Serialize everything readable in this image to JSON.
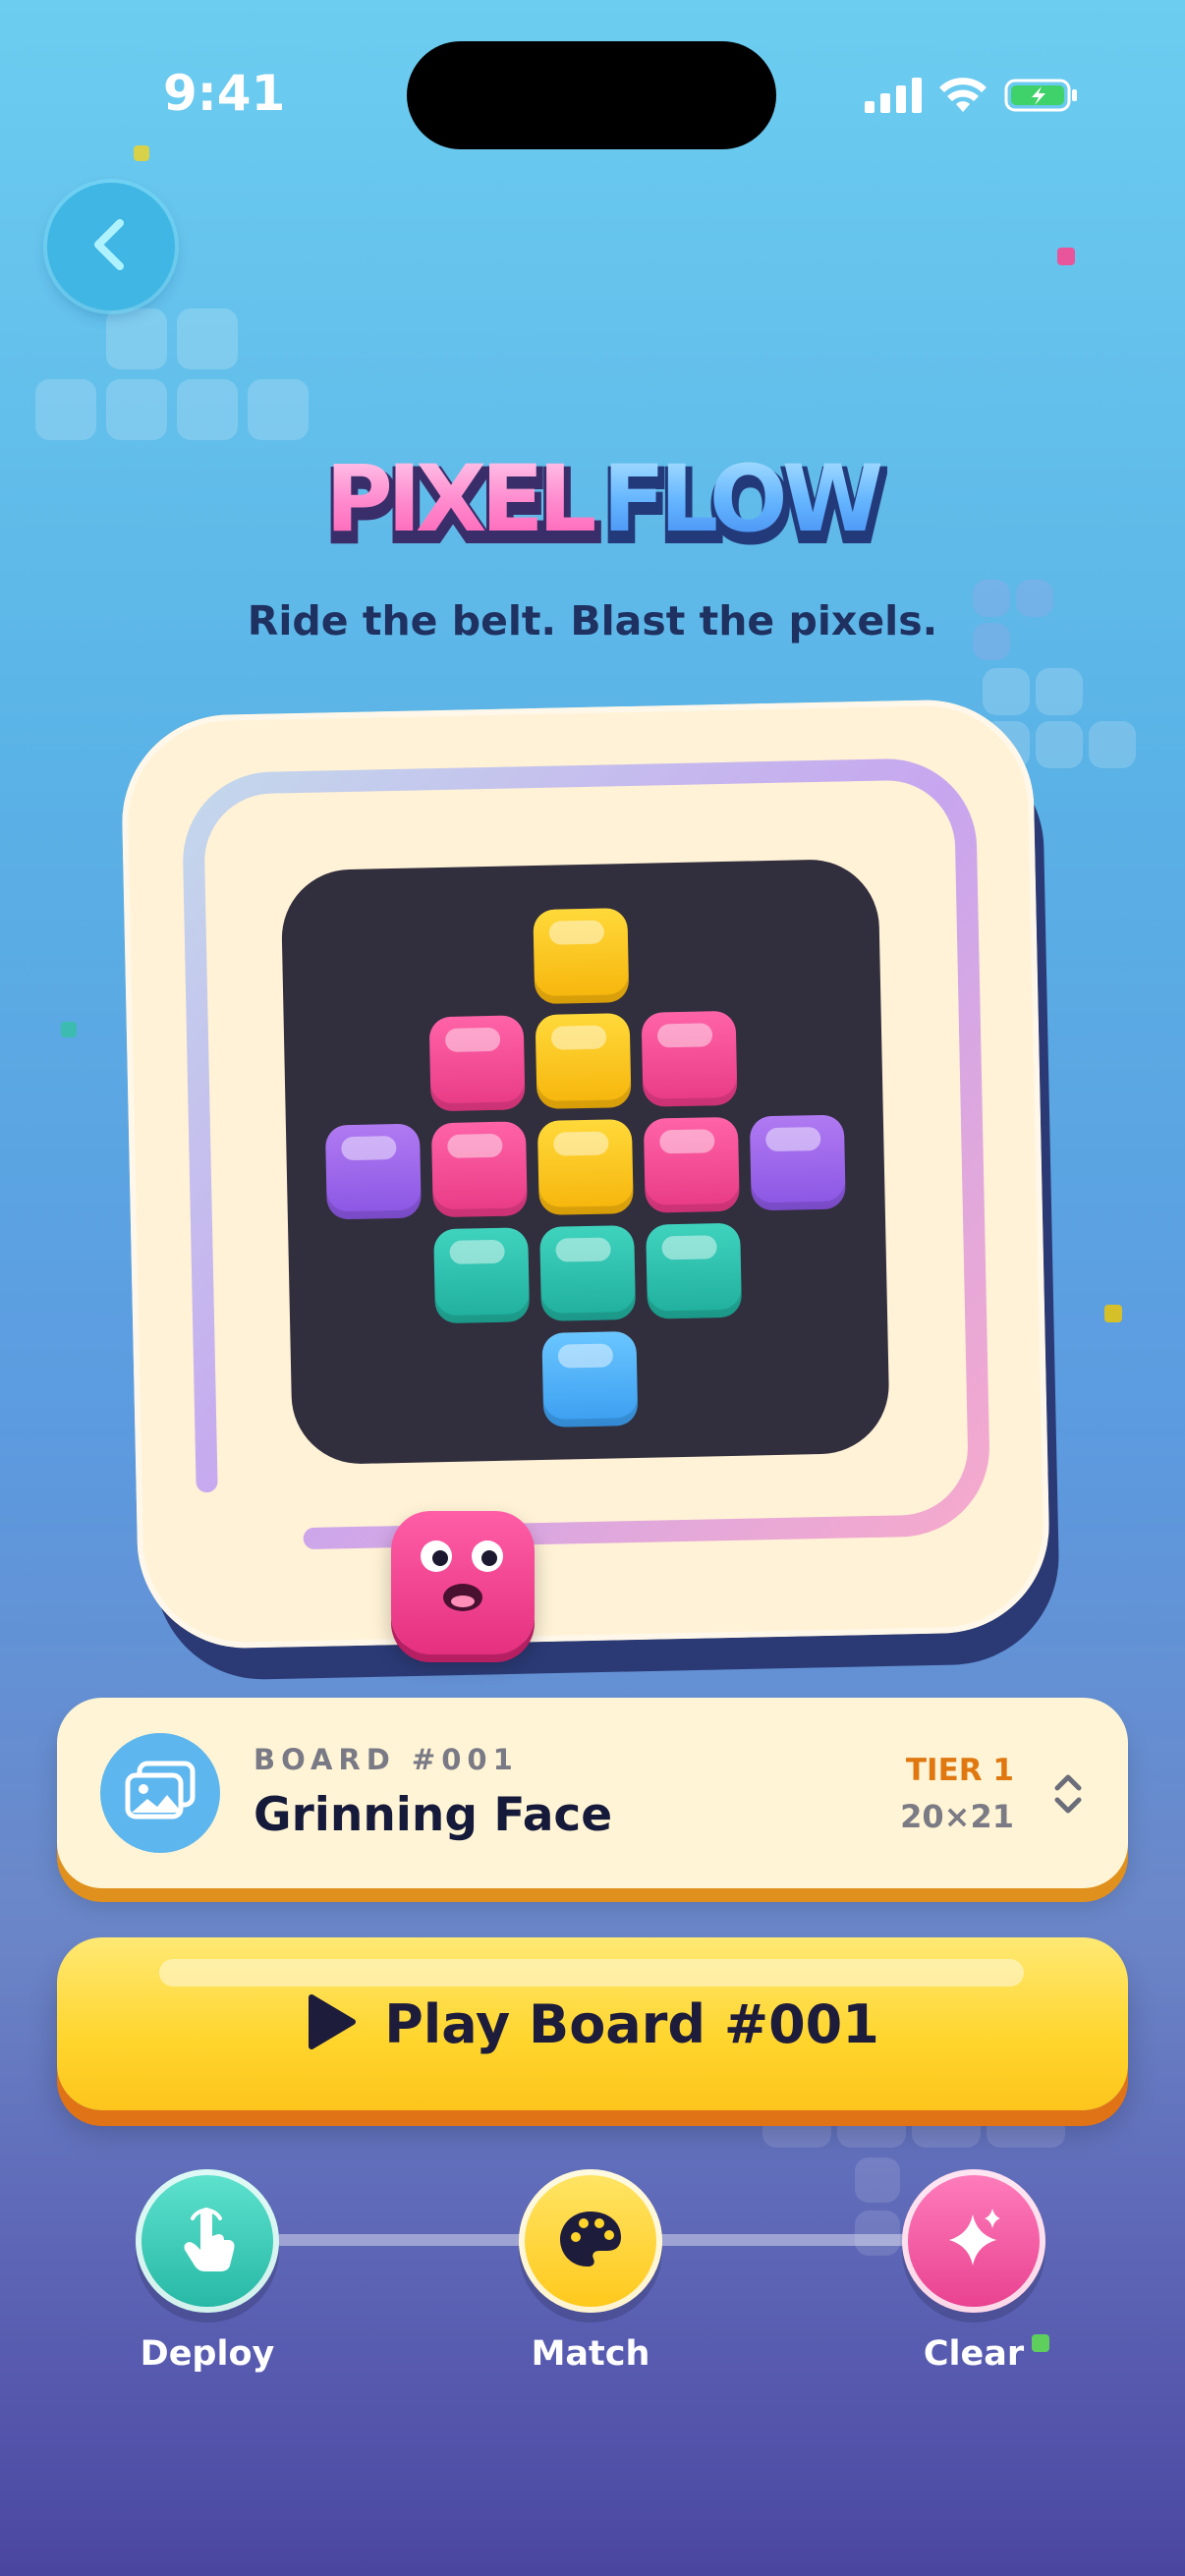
{
  "status_bar": {
    "time": "9:41"
  },
  "header": {
    "title_part1": "PIXEL",
    "title_part2": "FLOW",
    "tagline": "Ride the belt. Blast the pixels."
  },
  "board_card": {
    "board_number": "BOARD #001",
    "board_name": "Grinning Face",
    "tier": "TIER 1",
    "size": "20×21"
  },
  "play_button": {
    "label": "Play Board #001"
  },
  "steps": [
    {
      "label": "Deploy",
      "icon": "tap-hand-icon"
    },
    {
      "label": "Match",
      "icon": "palette-icon"
    },
    {
      "label": "Clear",
      "icon": "sparkles-icon"
    }
  ],
  "colors": {
    "yellow": "#ffd93a",
    "pink": "#ff63a8",
    "purple": "#b07af2",
    "teal": "#3fd3be",
    "blue": "#6ac6ff",
    "accent_orange": "#e07811"
  }
}
